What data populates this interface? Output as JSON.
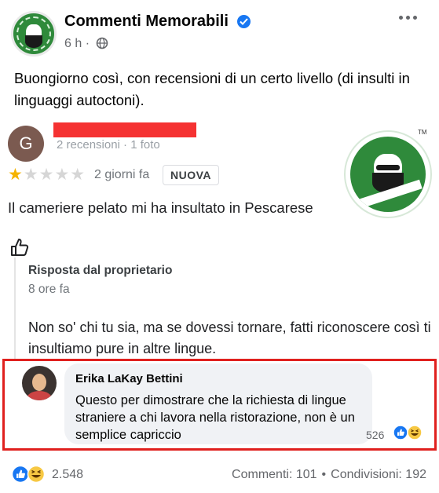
{
  "post": {
    "page_name": "Commenti Memorabili",
    "time": "6 h ·",
    "caption": "Buongiorno così, con recensioni di un certo livello (di insulti in linguaggi autoctoni)."
  },
  "review": {
    "avatar_letter": "G",
    "counts": "2 recensioni · 1 foto",
    "stars_filled": 1,
    "stars_total": 5,
    "stars_on": "★",
    "stars_off": "★★★★",
    "when": "2 giorni fa",
    "badge": "NUOVA",
    "text": "Il cameriere pelato mi ha insultato  in Pescarese",
    "owner_reply": {
      "title": "Risposta dal proprietario",
      "when": "8 ore fa",
      "text": "Non so' chi tu sia, ma se dovessi tornare, fatti riconoscere così ti insultiamo pure in altre lingue."
    },
    "logo_tm": "TM"
  },
  "comment": {
    "author": "Erika LaKay Bettini",
    "text": "Questo per dimostrare che la richiesta di lingue straniere a chi lavora nella ristorazione, non è un semplice capriccio",
    "reaction_count": "526"
  },
  "footer": {
    "reaction_count": "2.548",
    "comments": "Commenti: 101",
    "separator": "•",
    "shares": "Condivisioni: 192"
  },
  "colors": {
    "highlight_border": "#e0201e",
    "redaction": "#f53232",
    "like_blue": "#1877f2",
    "haha_yellow": "#f7c843",
    "logo_green": "#2f8a3b"
  }
}
